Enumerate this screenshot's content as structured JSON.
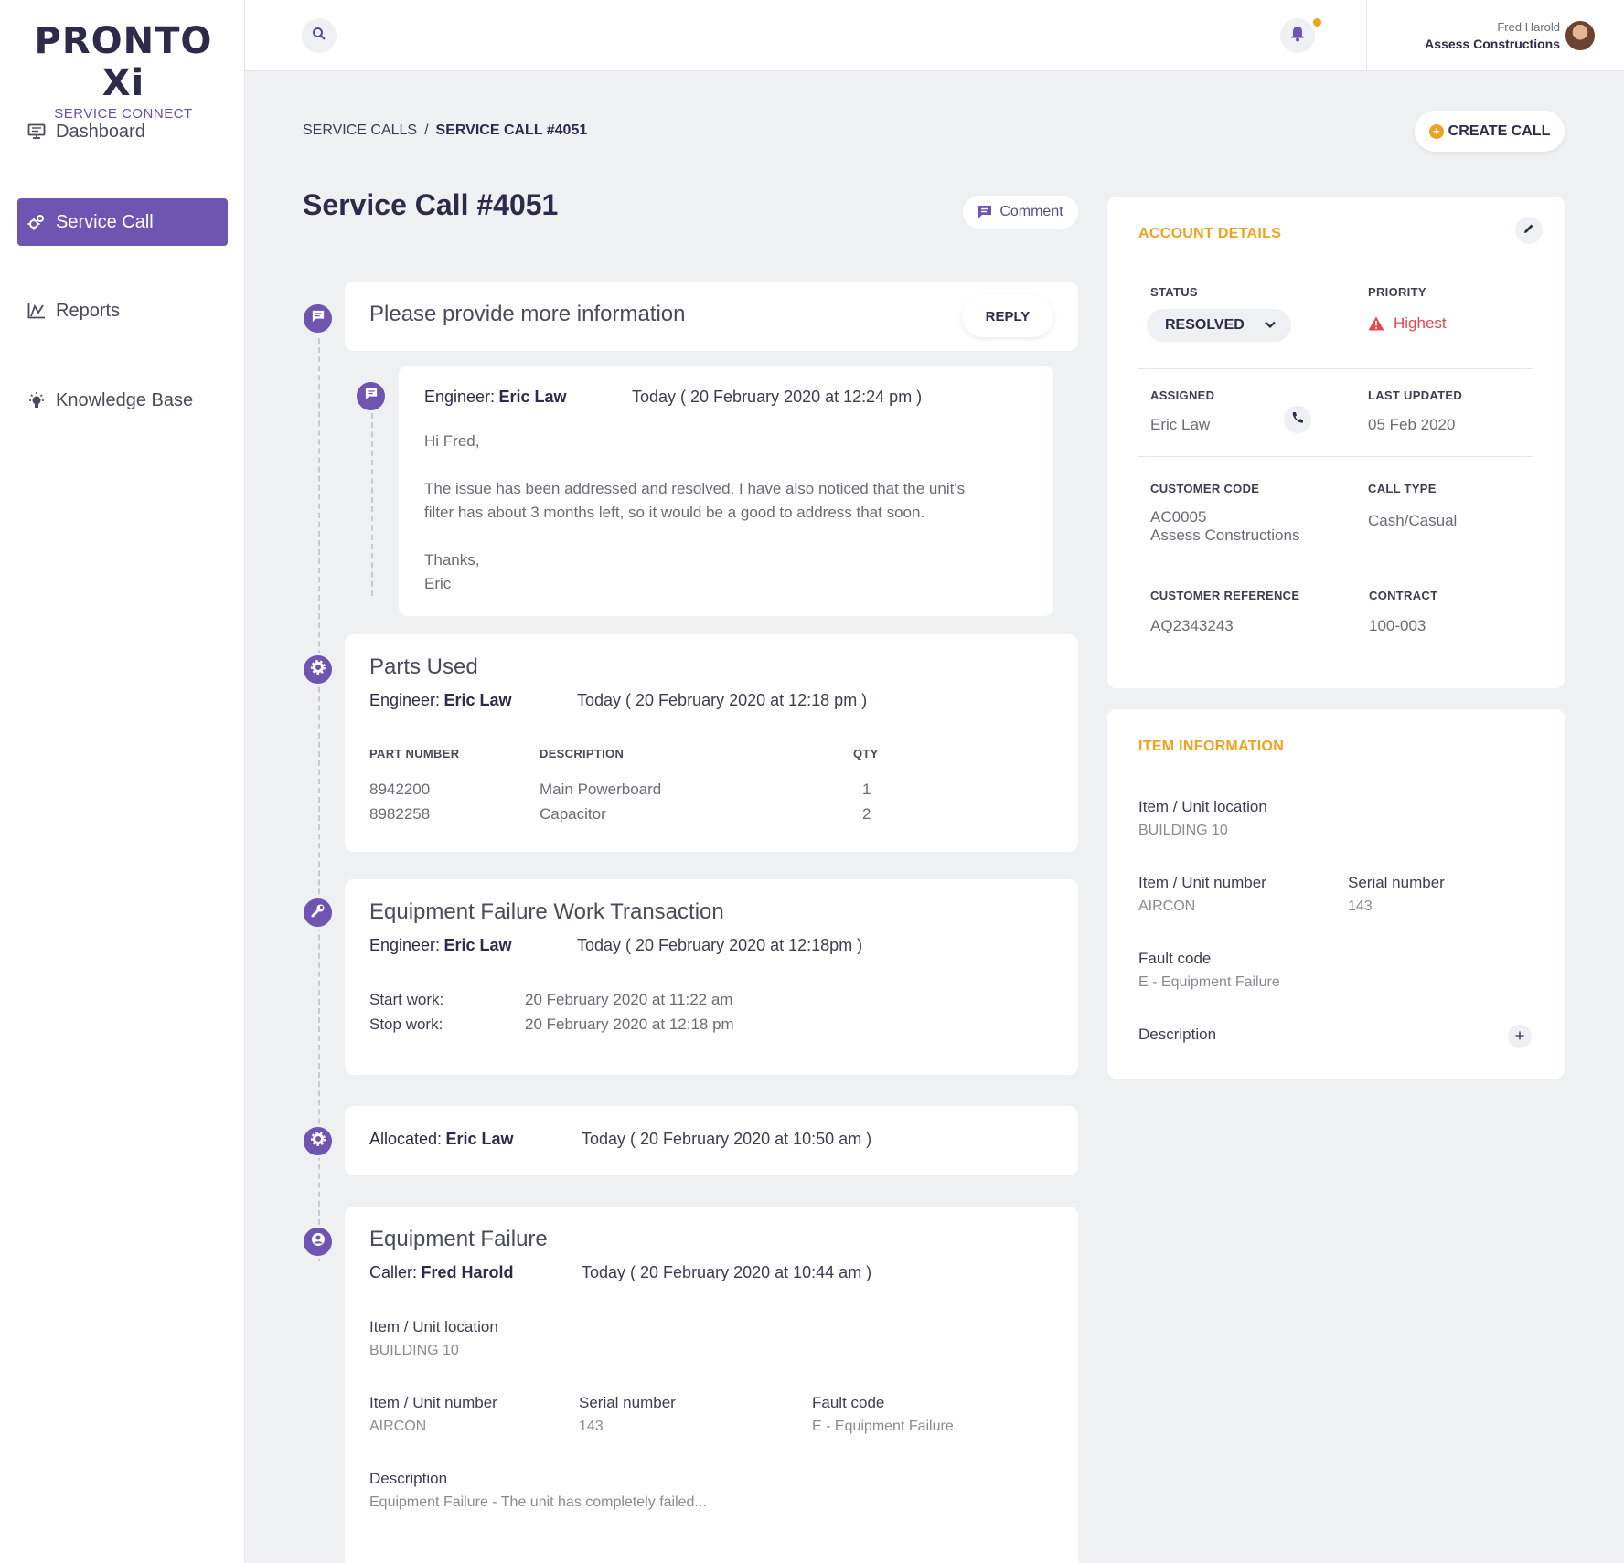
{
  "brand": {
    "name": "PRONTO Xi",
    "sub": "SERVICE CONNECT"
  },
  "nav": [
    {
      "label": "Dashboard"
    },
    {
      "label": "Service Call"
    },
    {
      "label": "Reports"
    },
    {
      "label": "Knowledge Base"
    }
  ],
  "user": {
    "name": "Fred Harold",
    "company": "Assess Constructions"
  },
  "breadcrumb": {
    "parent": "SERVICE CALLS",
    "separator": "/",
    "current": "SERVICE CALL #4051"
  },
  "actions": {
    "create_call": "CREATE CALL",
    "comment": "Comment",
    "reply": "REPLY"
  },
  "page_title": "Service Call #4051",
  "timeline": {
    "request": {
      "title": "Please provide more information"
    },
    "message": {
      "engineer_label": "Engineer:",
      "engineer": "Eric Law",
      "time": "Today ( 20 February 2020 at 12:24 pm )",
      "greeting": "Hi Fred,",
      "body_1": "The issue has been addressed and resolved.  I have also noticed that the unit's",
      "body_2": "filter has about 3 months left, so it would be a good to address that soon.",
      "sign_1": "Thanks,",
      "sign_2": "Eric"
    },
    "parts": {
      "title": "Parts Used",
      "engineer_label": "Engineer:",
      "engineer": "Eric Law",
      "time": "Today ( 20 February 2020 at 12:18 pm )",
      "headers": {
        "part": "PART NUMBER",
        "desc": "DESCRIPTION",
        "qty": "QTY"
      },
      "rows": [
        {
          "part": "8942200",
          "desc": "Main Powerboard",
          "qty": "1"
        },
        {
          "part": "8982258",
          "desc": "Capacitor",
          "qty": "2"
        }
      ]
    },
    "work": {
      "title": "Equipment Failure Work Transaction",
      "engineer_label": "Engineer:",
      "engineer": "Eric Law",
      "time": "Today ( 20 February 2020 at 12:18pm )",
      "start_label": "Start work:",
      "start": "20 February 2020 at 11:22 am",
      "stop_label": "Stop work:",
      "stop": "20 February 2020 at 12:18 pm"
    },
    "allocated": {
      "label": "Allocated:",
      "name": "Eric Law",
      "time": "Today ( 20 February 2020 at 10:50 am )"
    },
    "failure": {
      "title": "Equipment Failure",
      "caller_label": "Caller:",
      "caller": "Fred Harold",
      "time": "Today ( 20 February 2020 at 10:44 am )",
      "location_label": "Item / Unit location",
      "location": "BUILDING 10",
      "unit_label": "Item / Unit number",
      "unit": "AIRCON",
      "serial_label": "Serial number",
      "serial": "143",
      "fault_label": "Fault code",
      "fault": "E - Equipment Failure",
      "desc_label": "Description",
      "desc": "Equipment Failure -  The unit has completely failed..."
    }
  },
  "account": {
    "title": "ACCOUNT DETAILS",
    "status_label": "STATUS",
    "status": "RESOLVED",
    "priority_label": "PRIORITY",
    "priority": "Highest",
    "assigned_label": "ASSIGNED",
    "assigned": "Eric Law",
    "updated_label": "LAST UPDATED",
    "updated": "05 Feb 2020",
    "customer_code_label": "CUSTOMER CODE",
    "customer_code": "AC0005",
    "customer_name": "Assess Constructions",
    "call_type_label": "CALL TYPE",
    "call_type": "Cash/Casual",
    "customer_ref_label": "CUSTOMER REFERENCE",
    "customer_ref": "AQ2343243",
    "contract_label": "CONTRACT",
    "contract": "100-003"
  },
  "item": {
    "title": "ITEM INFORMATION",
    "location_label": "Item / Unit location",
    "location": "BUILDING 10",
    "unit_label": "Item / Unit number",
    "unit": "AIRCON",
    "serial_label": "Serial number",
    "serial": "143",
    "fault_label": "Fault code",
    "fault": "E - Equipment Failure",
    "desc_label": "Description"
  },
  "colors": {
    "accent": "#6f55b2",
    "highlight": "#f2a11f",
    "danger": "#e5484d"
  }
}
